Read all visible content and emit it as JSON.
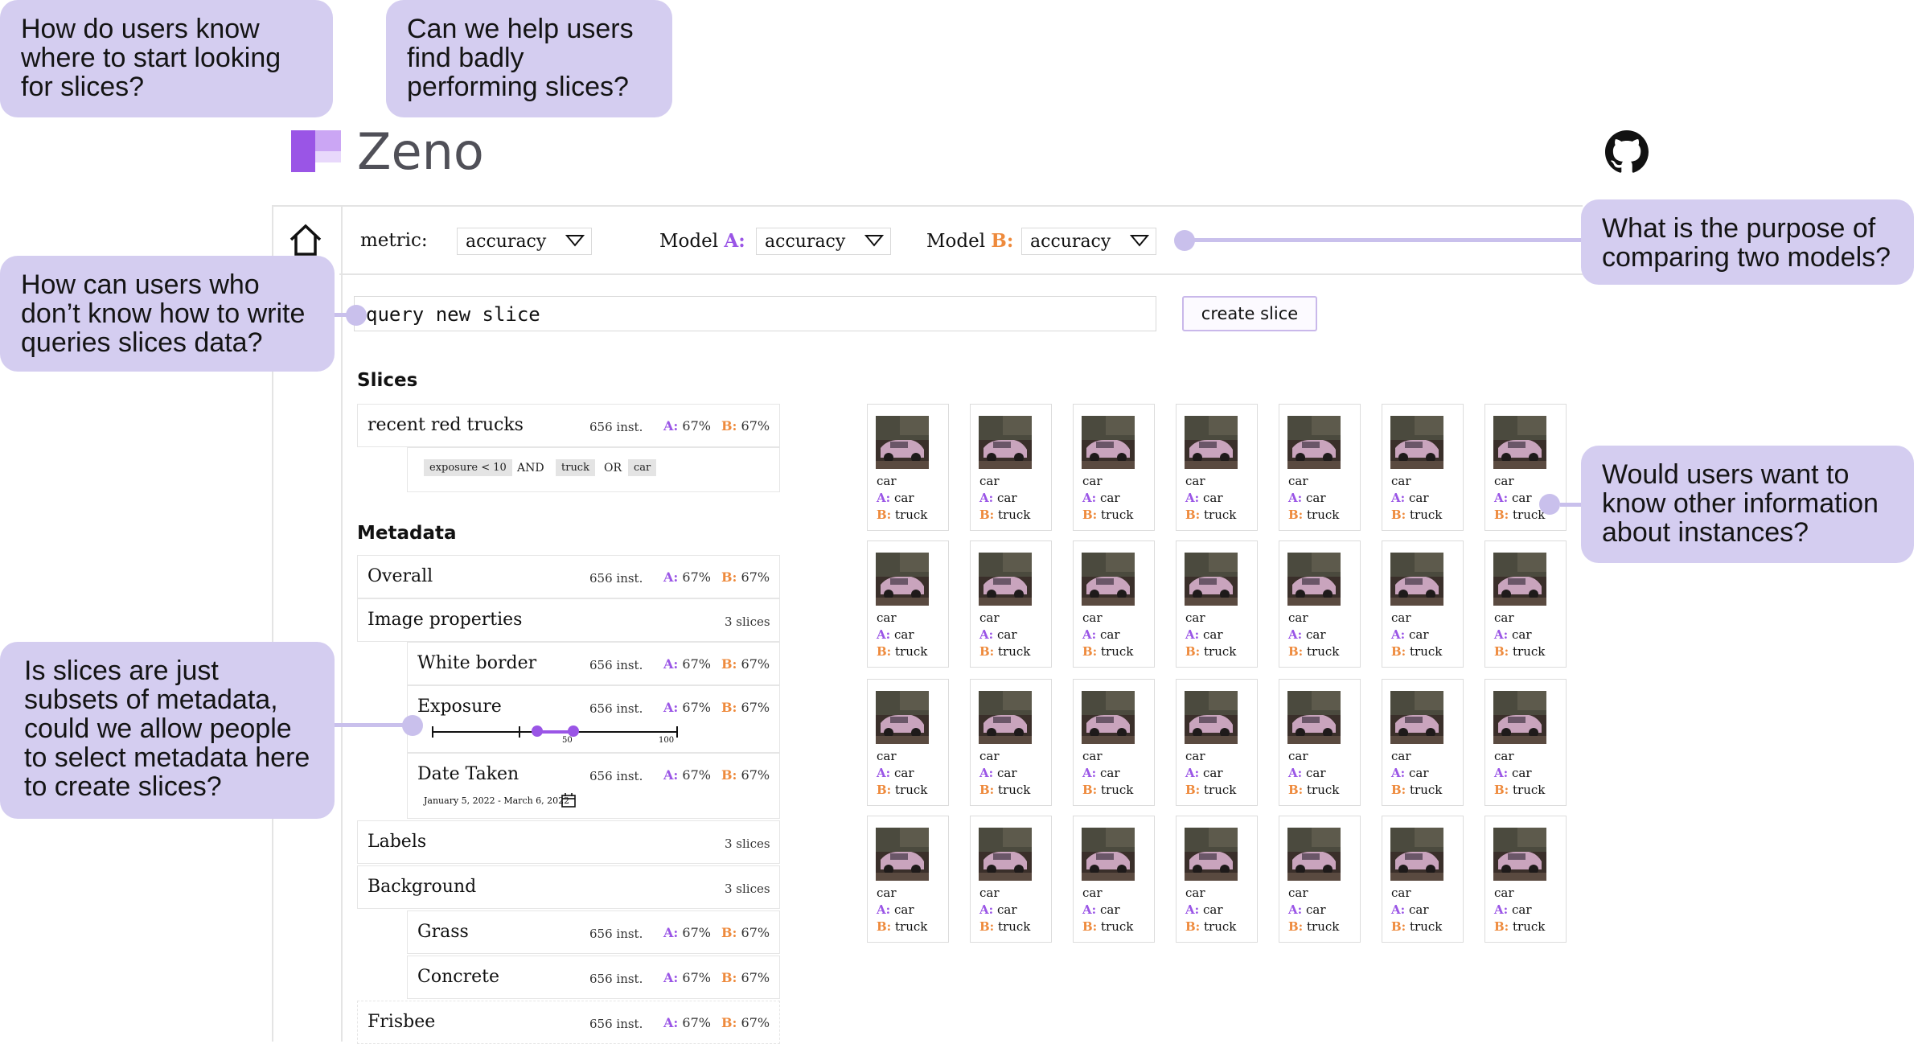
{
  "app": {
    "name": "Zeno"
  },
  "toolbar": {
    "metric_label": "metric:",
    "metric_value": "accuracy",
    "model_a_label": "Model",
    "model_a_letter": "A:",
    "model_a_value": "accuracy",
    "model_b_label": "Model",
    "model_b_letter": "B:",
    "model_b_value": "accuracy"
  },
  "query": {
    "placeholder": "query new slice",
    "button": "create slice"
  },
  "slices": {
    "heading": "Slices",
    "items": [
      {
        "name": "recent red trucks",
        "inst": "656 inst.",
        "a": "67%",
        "b": "67%"
      }
    ],
    "filter": {
      "chip1": "exposure < 10",
      "op1": "AND",
      "chip2": "truck",
      "op2": "OR",
      "chip3": "car"
    }
  },
  "metadata": {
    "heading": "Metadata",
    "rows": [
      {
        "name": "Overall",
        "inst": "656 inst.",
        "a": "67%",
        "b": "67%"
      },
      {
        "name": "Image properties",
        "count": "3 slices"
      },
      {
        "name": "White border",
        "inst": "656 inst.",
        "a": "67%",
        "b": "67%"
      },
      {
        "name": "Exposure",
        "inst": "656 inst.",
        "a": "67%",
        "b": "67%"
      },
      {
        "name": "Date Taken",
        "inst": "656 inst.",
        "a": "67%",
        "b": "67%",
        "date_range": "January 5, 2022 - March 6, 2022"
      },
      {
        "name": "Labels",
        "count": "3 slices"
      },
      {
        "name": "Background",
        "count": "3 slices"
      },
      {
        "name": "Grass",
        "inst": "656 inst.",
        "a": "67%",
        "b": "67%"
      },
      {
        "name": "Concrete",
        "inst": "656 inst.",
        "a": "67%",
        "b": "67%"
      },
      {
        "name": "Frisbee",
        "inst": "656 inst.",
        "a": "67%",
        "b": "67%"
      }
    ],
    "exposure_slider": {
      "tick_mid": "50",
      "tick_max": "100",
      "range_low": 0.43,
      "range_high": 0.58
    }
  },
  "metric_letters": {
    "a": "A:",
    "b": "B:"
  },
  "instance": {
    "label": "car",
    "a_pred": "car",
    "b_pred": "truck"
  },
  "callouts": {
    "c1": "How do users know where to start looking for slices?",
    "c2": "Can we help users find badly performing slices?",
    "c3": "What is the purpose of comparing two models?",
    "c4": "How can users who don’t know how to write queries slices data?",
    "c5": "Would users want to know other information about instances?",
    "c6": "Is slices are just subsets of metadata, could we allow people to select metadata here to create slices?"
  },
  "colors": {
    "model_a": "#9a55e6",
    "model_b": "#ee8a3c",
    "callout": "#d4cdf0"
  },
  "icons": {
    "home": "home-icon",
    "github": "github-icon",
    "calendar": "calendar-icon",
    "chevron": "chevron-down-icon"
  }
}
